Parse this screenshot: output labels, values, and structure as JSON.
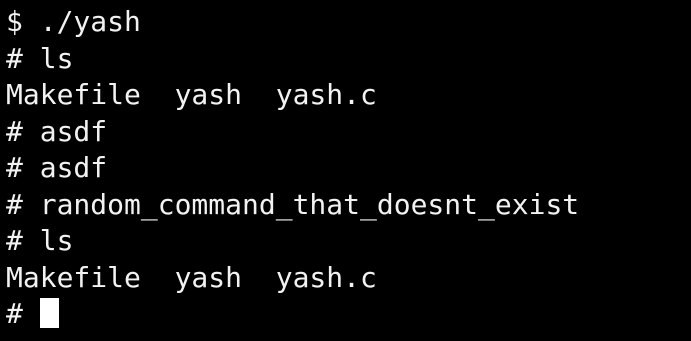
{
  "terminal": {
    "lines": [
      "$ ./yash",
      "# ls",
      "Makefile  yash  yash.c",
      "# asdf",
      "# asdf",
      "# random_command_that_doesnt_exist",
      "# ls",
      "Makefile  yash  yash.c"
    ],
    "prompt": "# ",
    "colors": {
      "background": "#000000",
      "foreground": "#f2f2f2",
      "cursor": "#ffffff"
    }
  }
}
